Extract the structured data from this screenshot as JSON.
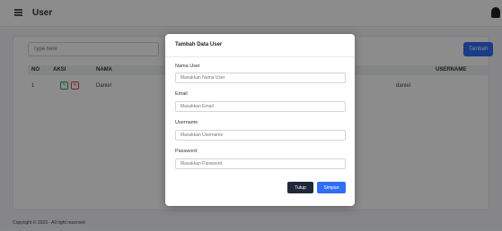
{
  "header": {
    "title": "User",
    "menu_icon": "hamburger-icon",
    "avatar_icon": "user-avatar"
  },
  "toolbar": {
    "search_placeholder": "Type here",
    "add_button": "Tambah"
  },
  "table": {
    "columns": [
      "NO",
      "AKSI",
      "NAMA",
      "USERNAME"
    ],
    "rows": [
      {
        "no": "1",
        "edit_icon": "✎",
        "delete_icon": "✕",
        "nama": "Daniel",
        "partial": "dan",
        "username": "daniel"
      }
    ]
  },
  "footer": {
    "copyright": "Copyright © 2023 - All right reserved"
  },
  "modal": {
    "title": "Tambah Data User",
    "fields": [
      {
        "label": "Nama User",
        "placeholder": "Masukkan Nama User"
      },
      {
        "label": "Email",
        "placeholder": "Masukkan Email"
      },
      {
        "label": "Username",
        "placeholder": "Masukkan Username"
      },
      {
        "label": "Password",
        "placeholder": "Masukkan Password"
      }
    ],
    "close_button": "Tutup",
    "save_button": "Simpan"
  },
  "colors": {
    "accent": "#2f6ef5",
    "dark": "#1f2937",
    "success": "#22a05b",
    "danger": "#e0453a"
  }
}
